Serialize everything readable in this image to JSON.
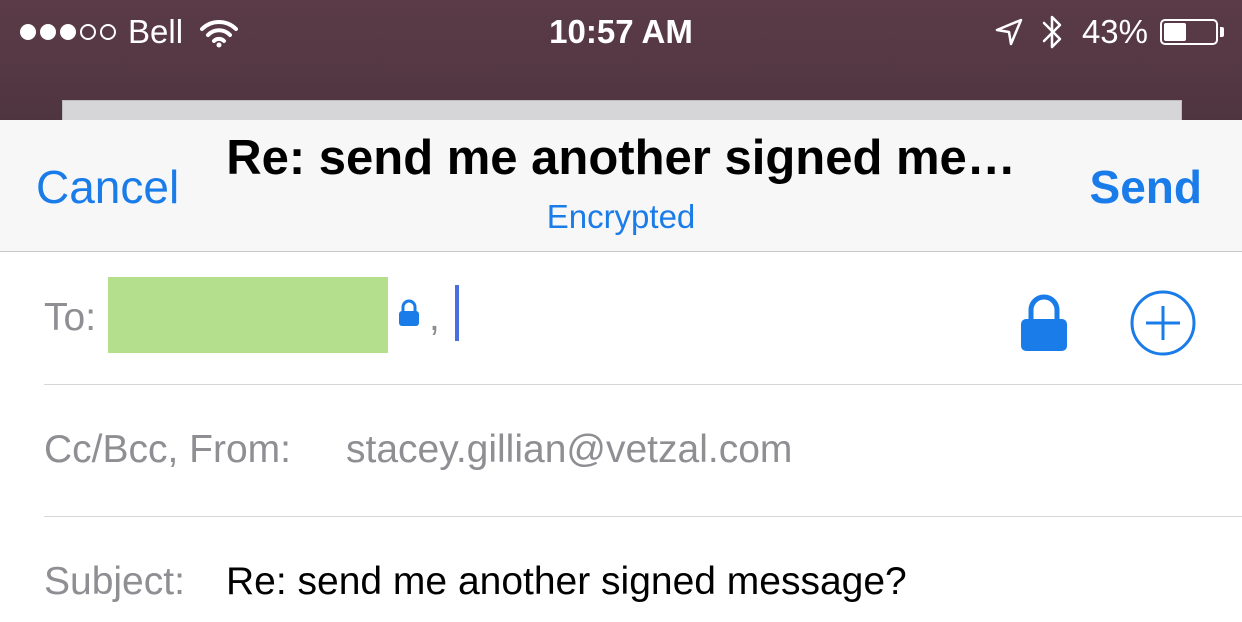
{
  "status_bar": {
    "signal_filled": 3,
    "signal_total": 5,
    "carrier": "Bell",
    "time": "10:57 AM",
    "battery_percent": "43%",
    "battery_level": 0.43,
    "icons": [
      "wifi-icon",
      "location-arrow-icon",
      "bluetooth-icon",
      "battery-icon"
    ]
  },
  "nav": {
    "cancel_label": "Cancel",
    "title": "Re: send me another signed me…",
    "subtitle": "Encrypted",
    "send_label": "Send"
  },
  "to_row": {
    "label": "To:",
    "separator": ",",
    "recipient_highlight_color": "#b4df8c",
    "icons": [
      "small-lock-icon",
      "lock-icon",
      "add-circle-icon"
    ]
  },
  "cc_row": {
    "label": "Cc/Bcc, From:",
    "from_value": "stacey.gillian@vetzal.com"
  },
  "subject_row": {
    "label": "Subject:",
    "value": "Re: send me another signed message?"
  },
  "colors": {
    "accent": "#1a7ce8",
    "status_bar_bg": "#563a45",
    "label_gray": "#8e8e93"
  }
}
